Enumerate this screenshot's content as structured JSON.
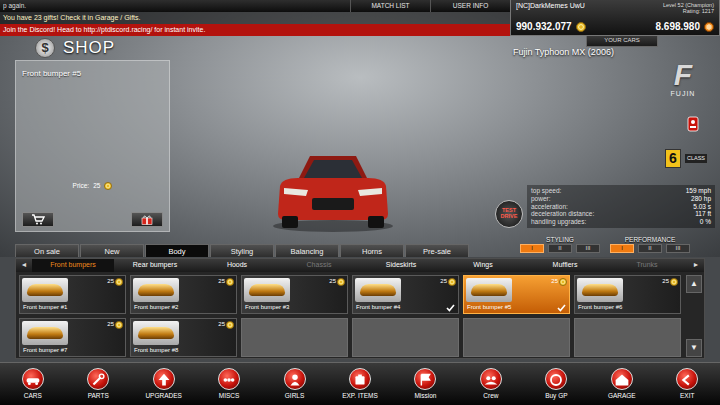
{
  "header": {
    "top_line": "p again.",
    "gifts": "You have 23 gifts! Check it in Garage / Gifts.",
    "discord": "Join the Discord! Head to http://ptdiscord.racing/ for instant invite."
  },
  "menu": [
    {
      "label": "MATCH LIST"
    },
    {
      "label": "USER INFO"
    }
  ],
  "user": {
    "name": "[NC]DarkMemes UwU",
    "level": "Level 52 (Champion)",
    "rating": "Rating: 1217",
    "money": "990.932.077",
    "gp": "8.698.980",
    "your_cars": "YOUR CARS"
  },
  "shop": {
    "icon": "$",
    "title": "SHOP",
    "item_name": "Front bumper #5",
    "price_label": "Price:",
    "price": "25"
  },
  "car": {
    "name": "Fujin Typhoon MX (2006)",
    "brand_mark": "F",
    "brand": "FUJIN",
    "class": "6",
    "class_label": "CLASS",
    "test_drive": "TEST DRIVE",
    "stats": [
      {
        "label": "top speed:",
        "value": "159 mph"
      },
      {
        "label": "power:",
        "value": "280 hp"
      },
      {
        "label": "acceleration:",
        "value": "5.03 s"
      },
      {
        "label": "deceleration distance:",
        "value": "117 ft"
      },
      {
        "label": "handling upgrades:",
        "value": "0 %"
      }
    ]
  },
  "upgrade_levels": [
    {
      "label": "STYLING",
      "levels": [
        {
          "label": "I",
          "selected": true
        },
        {
          "label": "II",
          "selected": false
        },
        {
          "label": "III",
          "selected": false
        }
      ]
    },
    {
      "label": "PERFORMANCE",
      "levels": [
        {
          "label": "I",
          "selected": true
        },
        {
          "label": "II",
          "selected": false
        },
        {
          "label": "III",
          "selected": false
        }
      ]
    }
  ],
  "tabs": [
    {
      "label": "On sale",
      "selected": false
    },
    {
      "label": "New",
      "selected": false
    },
    {
      "label": "Body",
      "selected": true
    },
    {
      "label": "Styling",
      "selected": false
    },
    {
      "label": "Balancing",
      "selected": false
    },
    {
      "label": "Horns",
      "selected": false
    },
    {
      "label": "Pre-sale",
      "selected": false
    }
  ],
  "subtabs": {
    "prev": "◄",
    "next": "►",
    "items": [
      {
        "label": "Front bumpers",
        "selected": true,
        "disabled": false
      },
      {
        "label": "Rear bumpers",
        "selected": false,
        "disabled": false
      },
      {
        "label": "Hoods",
        "selected": false,
        "disabled": false
      },
      {
        "label": "Chassis",
        "selected": false,
        "disabled": true
      },
      {
        "label": "Sideskirts",
        "selected": false,
        "disabled": false
      },
      {
        "label": "Wings",
        "selected": false,
        "disabled": false
      },
      {
        "label": "Mufflers",
        "selected": false,
        "disabled": false
      },
      {
        "label": "Trunks",
        "selected": false,
        "disabled": true
      }
    ]
  },
  "grid": {
    "up": "▲",
    "down": "▼",
    "items": [
      {
        "kind": "item",
        "name": "Front bumper #1",
        "price": "25",
        "owned": false,
        "selected": false
      },
      {
        "kind": "item",
        "name": "Front bumper #2",
        "price": "25",
        "owned": false,
        "selected": false
      },
      {
        "kind": "item",
        "name": "Front bumper #3",
        "price": "25",
        "owned": false,
        "selected": false
      },
      {
        "kind": "item",
        "name": "Front bumper #4",
        "price": "25",
        "owned": true,
        "selected": false
      },
      {
        "kind": "item",
        "name": "Front bumper #5",
        "price": "25",
        "owned": true,
        "selected": true
      },
      {
        "kind": "item",
        "name": "Front bumper #6",
        "price": "25",
        "owned": false,
        "selected": false
      },
      {
        "kind": "item",
        "name": "Front bumper #7",
        "price": "25",
        "owned": false,
        "selected": false
      },
      {
        "kind": "item",
        "name": "Front bumper #8",
        "price": "25",
        "owned": false,
        "selected": false
      },
      {
        "kind": "empty"
      },
      {
        "kind": "empty"
      },
      {
        "kind": "empty"
      },
      {
        "kind": "empty"
      }
    ]
  },
  "nav": [
    {
      "label": "CARS"
    },
    {
      "label": "PARTS"
    },
    {
      "label": "UPGRADES"
    },
    {
      "label": "MISCS"
    },
    {
      "label": "GIRLS"
    },
    {
      "label": "EXP. ITEMS"
    },
    {
      "label": "Mission"
    },
    {
      "label": "Crew"
    },
    {
      "label": "Buy GP"
    },
    {
      "label": "GARAGE"
    },
    {
      "label": "EXIT"
    }
  ]
}
